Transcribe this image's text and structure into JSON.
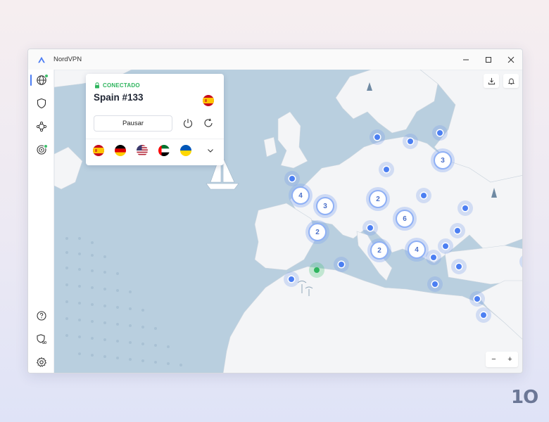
{
  "window": {
    "title": "NordVPN"
  },
  "connection": {
    "status": "CONECTADO",
    "server": "Spain #133",
    "pause_label": "Pausar"
  },
  "quick_connect_flags": [
    "spain-flag",
    "germany-flag",
    "usa-flag",
    "uae-flag",
    "ukraine-flag"
  ],
  "map_clusters": [
    {
      "id": "uk",
      "count": "4"
    },
    {
      "id": "benelux",
      "count": "3"
    },
    {
      "id": "germany",
      "count": "2"
    },
    {
      "id": "france",
      "count": "2"
    },
    {
      "id": "poland",
      "count": "6"
    },
    {
      "id": "italy",
      "count": "2"
    },
    {
      "id": "balkans",
      "count": "4"
    },
    {
      "id": "finland",
      "count": "3"
    }
  ],
  "zoom": {
    "minus": "−",
    "plus": "+"
  },
  "colors": {
    "accent": "#4b7cf3",
    "connected": "#2fb55e",
    "sea": "#b9cfdf",
    "land": "#f4f5f7"
  },
  "brand": "1O"
}
